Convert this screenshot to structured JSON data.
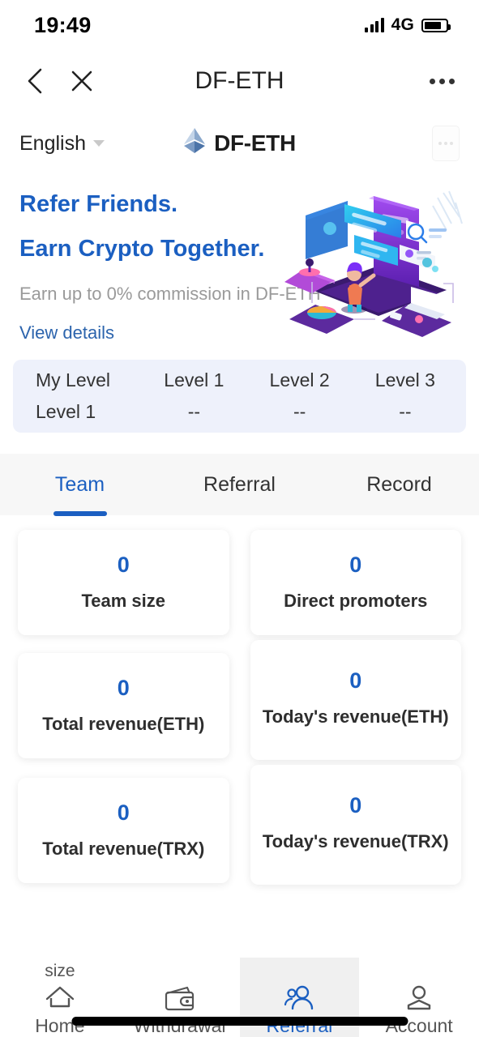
{
  "status_bar": {
    "time": "19:49",
    "network": "4G",
    "signal_icon": "signal-bars-icon",
    "battery_icon": "battery-icon"
  },
  "browser_nav": {
    "back_icon": "chevron-left-icon",
    "close_icon": "close-x-icon",
    "title": "DF-ETH",
    "more_icon": "more-horizontal-icon"
  },
  "app_header": {
    "language": "English",
    "language_caret_icon": "chevron-down-icon",
    "brand_logo_icon": "ethereum-diamond-icon",
    "brand_name": "DF-ETH",
    "more_icon": "more-horizontal-icon"
  },
  "hero": {
    "headline_1": "Refer Friends.",
    "headline_2": "Earn Crypto Together.",
    "subtitle": "Earn up to 0% commission in DF-ETH",
    "link": "View details",
    "illustration_icon": "referral-isometric-illustration"
  },
  "levels": {
    "columns": [
      {
        "title": "My Level",
        "value": "Level 1"
      },
      {
        "title": "Level 1",
        "value": "--"
      },
      {
        "title": "Level 2",
        "value": "--"
      },
      {
        "title": "Level 3",
        "value": "--"
      }
    ]
  },
  "tabs": {
    "items": [
      {
        "label": "Team",
        "active": true
      },
      {
        "label": "Referral",
        "active": false
      },
      {
        "label": "Record",
        "active": false
      }
    ]
  },
  "stats": {
    "rows": [
      [
        {
          "value": "0",
          "label": "Team size"
        },
        {
          "value": "0",
          "label": "Direct promoters"
        }
      ],
      [
        {
          "value": "0",
          "label": "Total revenue(ETH)"
        },
        {
          "value": "0",
          "label": "Today's revenue(ETH)"
        }
      ],
      [
        {
          "value": "0",
          "label": "Total revenue(TRX)"
        },
        {
          "value": "0",
          "label": "Today's revenue(TRX)"
        }
      ]
    ]
  },
  "bottom_nav": {
    "items": [
      {
        "label": "Home",
        "icon": "home-icon",
        "overflow_text": "size",
        "active": false
      },
      {
        "label": "Withdrawal",
        "icon": "wallet-icon",
        "active": false
      },
      {
        "label": "Referral",
        "icon": "users-icon",
        "active": true
      },
      {
        "label": "Account",
        "icon": "person-icon",
        "active": false
      }
    ]
  },
  "colors": {
    "accent_blue": "#1b5fc1",
    "level_panel_bg": "#eef1fb",
    "tab_strip_bg": "#f7f7f7",
    "active_nav_bg": "#f0f0f0",
    "muted_text": "#9a9a9a"
  }
}
